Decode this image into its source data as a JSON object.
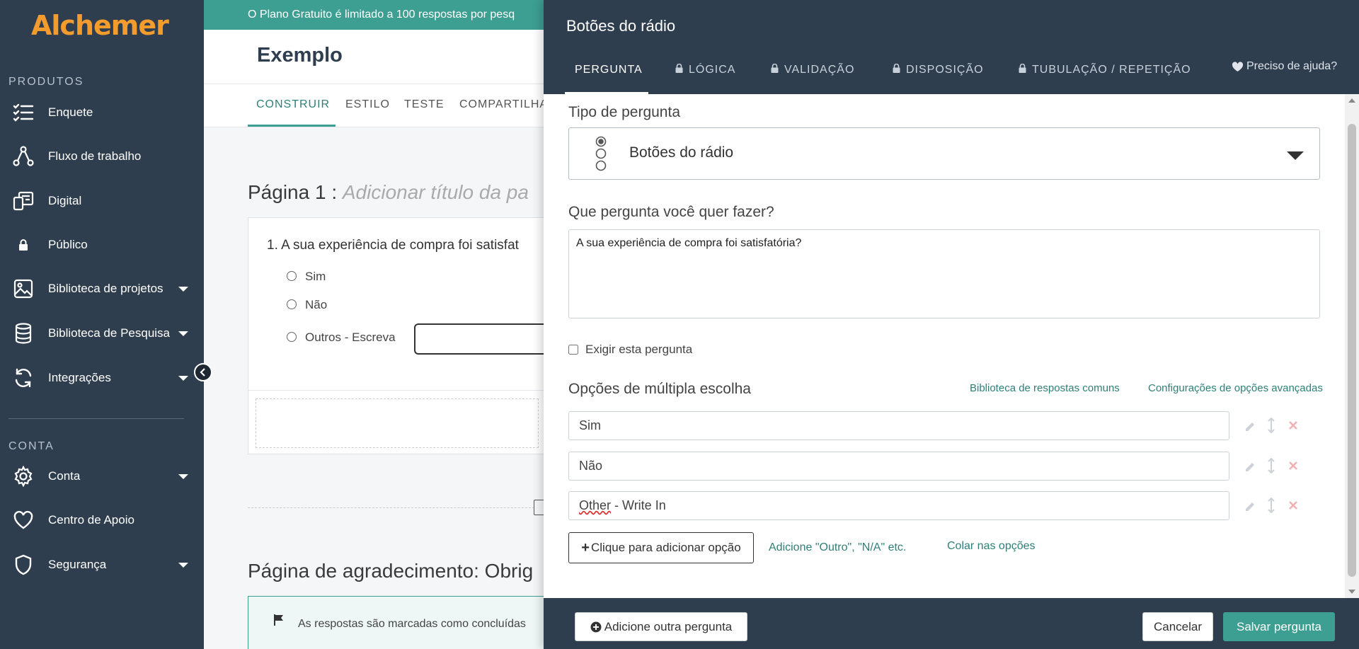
{
  "sidebar": {
    "logo": "Alchemer",
    "section_products": "PRODUTOS",
    "section_account": "CONTA",
    "items": [
      {
        "label": "Enquete",
        "icon": "checklist-icon"
      },
      {
        "label": "Fluxo de trabalho",
        "icon": "workflow-icon"
      },
      {
        "label": "Digital",
        "icon": "digital-icon"
      },
      {
        "label": "Público",
        "icon": "lock-icon"
      },
      {
        "label": "Biblioteca de projetos",
        "icon": "image-icon"
      },
      {
        "label": "Biblioteca de Pesquisa",
        "icon": "database-icon"
      },
      {
        "label": "Integrações",
        "icon": "sync-icon"
      },
      {
        "label": "Conta",
        "icon": "gear-icon"
      },
      {
        "label": "Centro de Apoio",
        "icon": "heart-icon"
      },
      {
        "label": "Segurança",
        "icon": "shield-icon"
      }
    ]
  },
  "banner": {
    "text": "O Plano Gratuito é limitado a 100 respostas por pesq"
  },
  "survey": {
    "title": "Exemplo",
    "tabs": [
      "CONSTRUIR",
      "ESTILO",
      "TESTE",
      "COMPARTILHA"
    ],
    "page_heading": "Página 1 : ",
    "page_title_placeholder": "Adicionar título da pa",
    "question": "1. A sua experiência de compra foi satisfat",
    "options": [
      "Sim",
      "Não",
      "Outros - Escreva"
    ],
    "thanks_heading": "Página de agradecimento: Obrig",
    "thanks_text": "As respostas são marcadas como concluídas"
  },
  "dialog": {
    "title": "Botões do rádio",
    "tabs": [
      "PERGUNTA",
      "LÓGICA",
      "VALIDAÇÃO",
      "DISPOSIÇÃO",
      "TUBULAÇÃO / REPETIÇÃO"
    ],
    "help": "Preciso de ajuda?",
    "type_label": "Tipo de pergunta",
    "type_value": "Botões do rádio",
    "question_label": "Que pergunta você quer fazer?",
    "question_value": "A sua experiência de compra foi satisfatória?",
    "require_label": "Exigir esta pergunta",
    "options_label": "Opções de múltipla escolha",
    "common_answers_link": "Biblioteca de respostas comuns",
    "advanced_link": "Configurações de opções avançadas",
    "options": [
      "Sim",
      "Não"
    ],
    "other_option_word": "Other",
    "other_option_rest": " - Write In",
    "add_option": "Clique para adicionar opção",
    "add_other_link": "Adicione \"Outro\", \"N/A\" etc.",
    "paste_link": "Colar nas opções",
    "add_question": "Adicione outra pergunta",
    "cancel": "Cancelar",
    "save": "Salvar pergunta"
  },
  "colors": {
    "accent": "#3d9e92",
    "sidebar": "#2f3e4e",
    "logo": "#f39c2d"
  }
}
